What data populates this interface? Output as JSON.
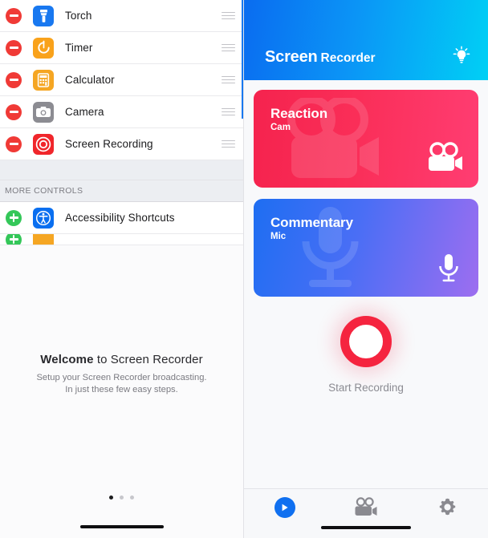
{
  "left_panel": {
    "include_section": {
      "rows": [
        {
          "label": "Torch",
          "icon": "torch-icon",
          "action": "remove"
        },
        {
          "label": "Timer",
          "icon": "timer-icon",
          "action": "remove"
        },
        {
          "label": "Calculator",
          "icon": "calculator-icon",
          "action": "remove"
        },
        {
          "label": "Camera",
          "icon": "camera-icon",
          "action": "remove"
        },
        {
          "label": "Screen Recording",
          "icon": "screen-recording-icon",
          "action": "remove"
        }
      ]
    },
    "more_controls": {
      "header": "MORE CONTROLS",
      "rows": [
        {
          "label": "Accessibility Shortcuts",
          "icon": "accessibility-icon",
          "action": "add"
        }
      ]
    },
    "welcome": {
      "title_bold": "Welcome",
      "title_rest": " to Screen Recorder",
      "line1": "Setup your Screen Recorder broadcasting.",
      "line2": "In just these few easy steps."
    },
    "pager": {
      "total": 3,
      "active": 1
    }
  },
  "right_panel": {
    "header": {
      "title_bold": "Screen",
      "title_light": "Recorder",
      "action_icon": "lightbulb-icon"
    },
    "cards": [
      {
        "title": "Reaction",
        "subtitle": "Cam",
        "icon": "video-camera-icon",
        "watermark": "video-camera-watermark",
        "color": "#fa2e58"
      },
      {
        "title": "Commentary",
        "subtitle": "Mic",
        "icon": "microphone-icon",
        "watermark": "microphone-watermark",
        "color": "#4a6ef5"
      }
    ],
    "record": {
      "label": "Start Recording",
      "color": "#f5243f"
    },
    "tabs": [
      {
        "name": "record",
        "icon": "play-icon",
        "active": true
      },
      {
        "name": "videos",
        "icon": "video-camera-icon",
        "active": false
      },
      {
        "name": "settings",
        "icon": "gear-icon",
        "active": false
      }
    ]
  },
  "colors": {
    "header_start": "#0a6cf0",
    "header_end": "#00d0f5",
    "accent_blue": "#1070f0",
    "record_red": "#f5243f",
    "remove_red": "#f03a36",
    "add_green": "#34c759"
  }
}
